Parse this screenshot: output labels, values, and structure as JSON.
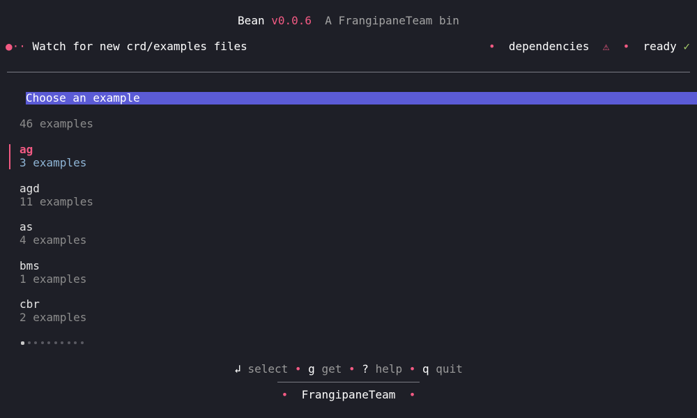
{
  "title": {
    "app_name": "Bean",
    "version": "v0.0.6",
    "tagline": "A FrangipaneTeam bin"
  },
  "status": {
    "spinner": "●··",
    "task": "Watch for new crd/examples files",
    "dot": "•",
    "dependencies_label": "dependencies",
    "dependencies_icon": "⚠",
    "ready_label": "ready",
    "ready_icon": "✓"
  },
  "list": {
    "header": "Choose an example",
    "count_label": "46 examples",
    "items": [
      {
        "name": "ag",
        "sub": "3 examples",
        "selected": true
      },
      {
        "name": "agd",
        "sub": "11 examples",
        "selected": false
      },
      {
        "name": "as",
        "sub": "4 examples",
        "selected": false
      },
      {
        "name": "bms",
        "sub": "1 examples",
        "selected": false
      },
      {
        "name": "cbr",
        "sub": "2 examples",
        "selected": false
      }
    ],
    "pagination": {
      "pages": 10,
      "current": 1
    }
  },
  "help": {
    "select_key": "↲",
    "select_label": "select",
    "get_key": "g",
    "get_label": "get",
    "help_key": "?",
    "help_label": "help",
    "quit_key": "q",
    "quit_label": "quit",
    "sep": "•"
  },
  "footer": {
    "dot": "•",
    "team": "FrangipaneTeam"
  },
  "colors": {
    "background": "#1e1f27",
    "accent": "#f25a83",
    "highlight": "#5b5bd6",
    "ok": "#a8cf6b",
    "selected_sub": "#8fb5d6"
  }
}
